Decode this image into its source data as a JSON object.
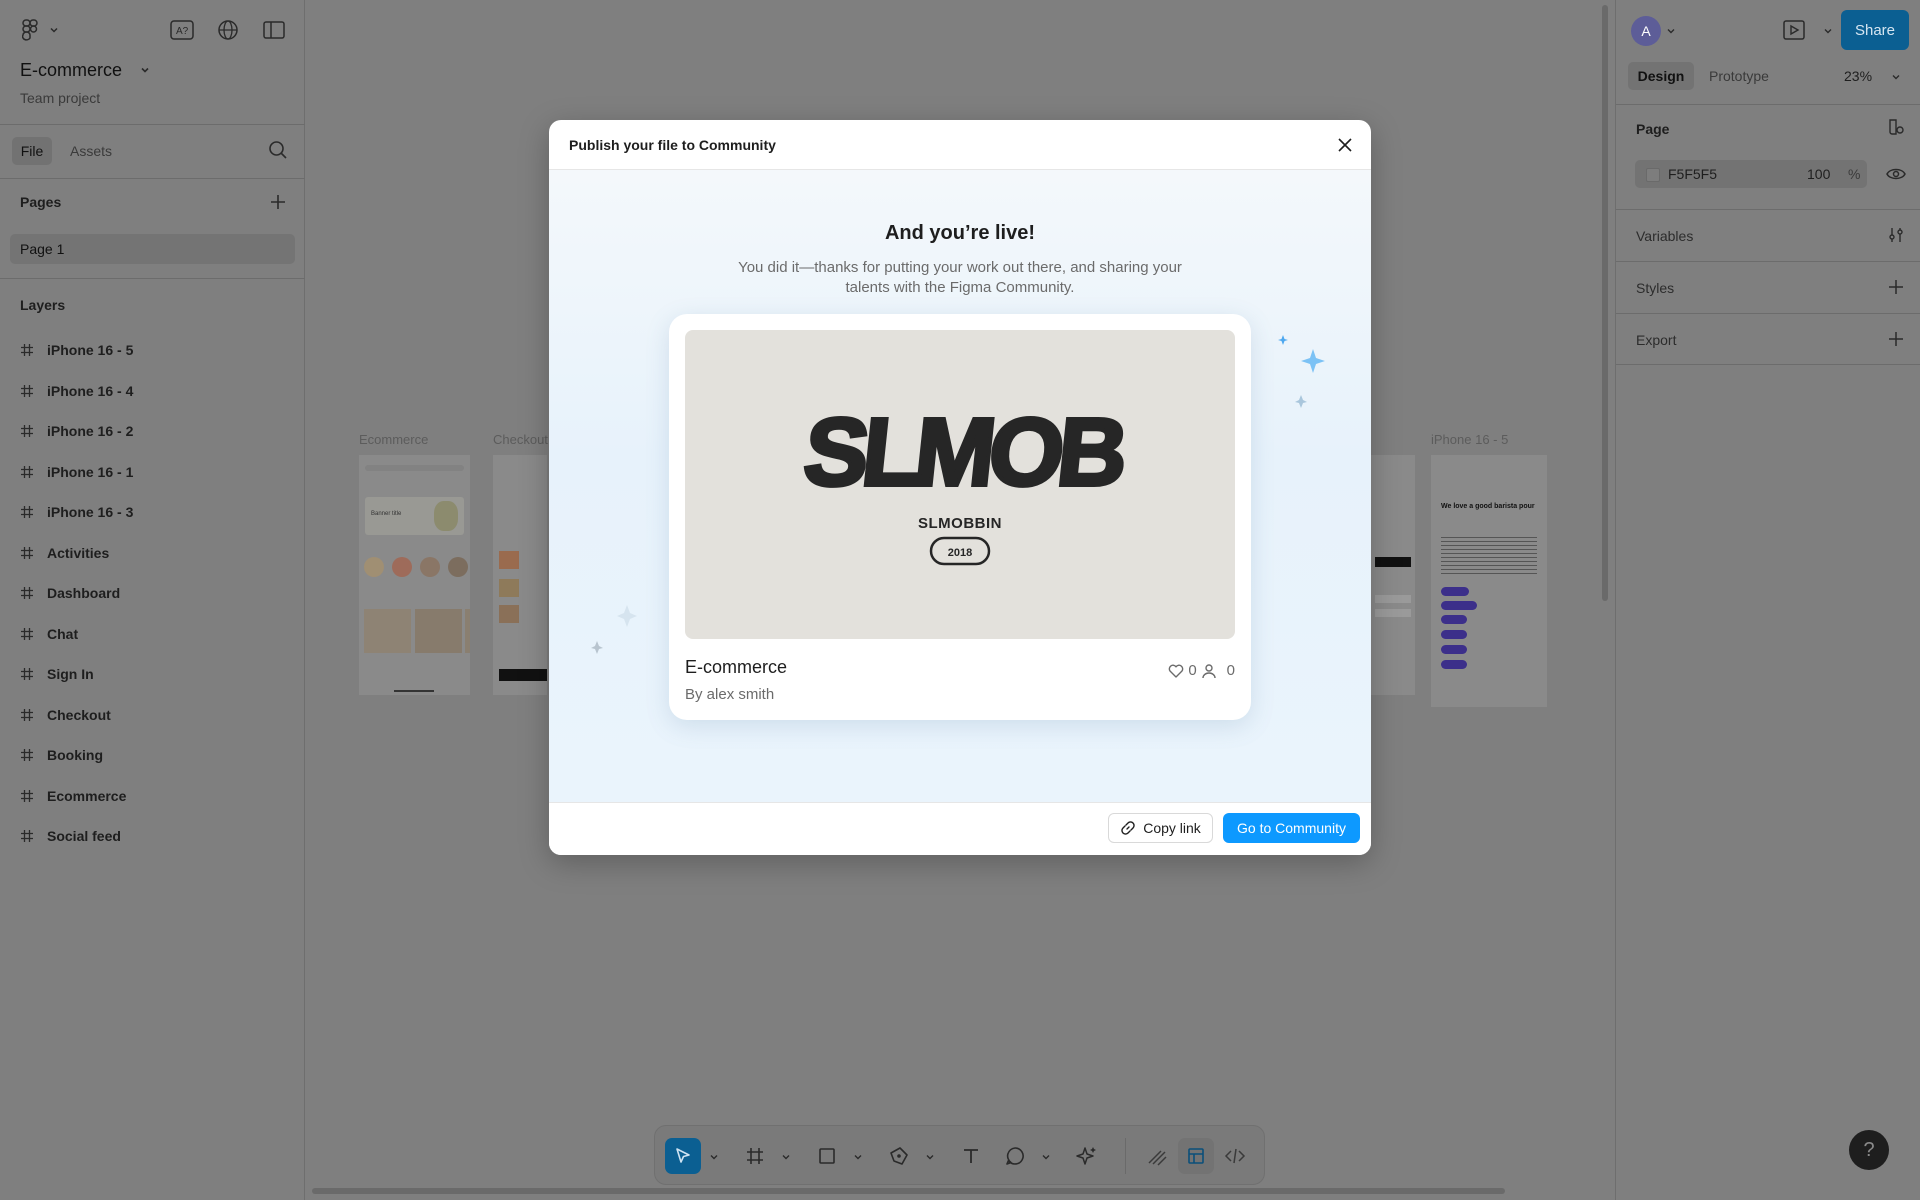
{
  "app": {
    "file_name": "E-commerce",
    "project": "Team project",
    "tabs": {
      "file": "File",
      "assets": "Assets"
    }
  },
  "pages": {
    "heading": "Pages",
    "items": [
      "Page 1"
    ]
  },
  "layers": {
    "heading": "Layers",
    "items": [
      "iPhone 16 - 5",
      "iPhone 16 - 4",
      "iPhone 16 - 2",
      "iPhone 16 - 1",
      "iPhone 16 - 3",
      "Activities",
      "Dashboard",
      "Chat",
      "Sign In",
      "Checkout",
      "Booking",
      "Ecommerce",
      "Social feed"
    ]
  },
  "canvas": {
    "frame_labels": {
      "ecommerce": "Ecommerce",
      "checkout": "Checkout",
      "iphone5": "iPhone 16 - 5"
    },
    "thumb_texts": {
      "banner": "Banner title",
      "barista_heading": "We love a good barista pour"
    }
  },
  "right_panel": {
    "avatar_initial": "A",
    "share_label": "Share",
    "tabs": {
      "design": "Design",
      "prototype": "Prototype"
    },
    "zoom": "23%",
    "page_heading": "Page",
    "page_color": "F5F5F5",
    "page_opacity": "100",
    "page_opacity_unit": "%",
    "variables": "Variables",
    "styles": "Styles",
    "export": "Export"
  },
  "modal": {
    "title": "Publish your file to Community",
    "headline": "And you’re live!",
    "subtext": "You did it—thanks for putting your work out there, and sharing your talents with the Figma Community.",
    "card": {
      "logo_text": "SLMOB",
      "logo_sub": "SLMOBBIN",
      "logo_year": "2018",
      "name": "E-commerce",
      "author": "By alex smith",
      "likes": "0",
      "users": "0"
    },
    "copy_link": "Copy link",
    "go_community": "Go to Community"
  },
  "help": "?",
  "colors": {
    "overlay_bg": "#7f7f7f",
    "primary_blue": "#0d99ff",
    "share_blue": "#0b5f92",
    "sparkle_blue": "#4ea8ef"
  }
}
